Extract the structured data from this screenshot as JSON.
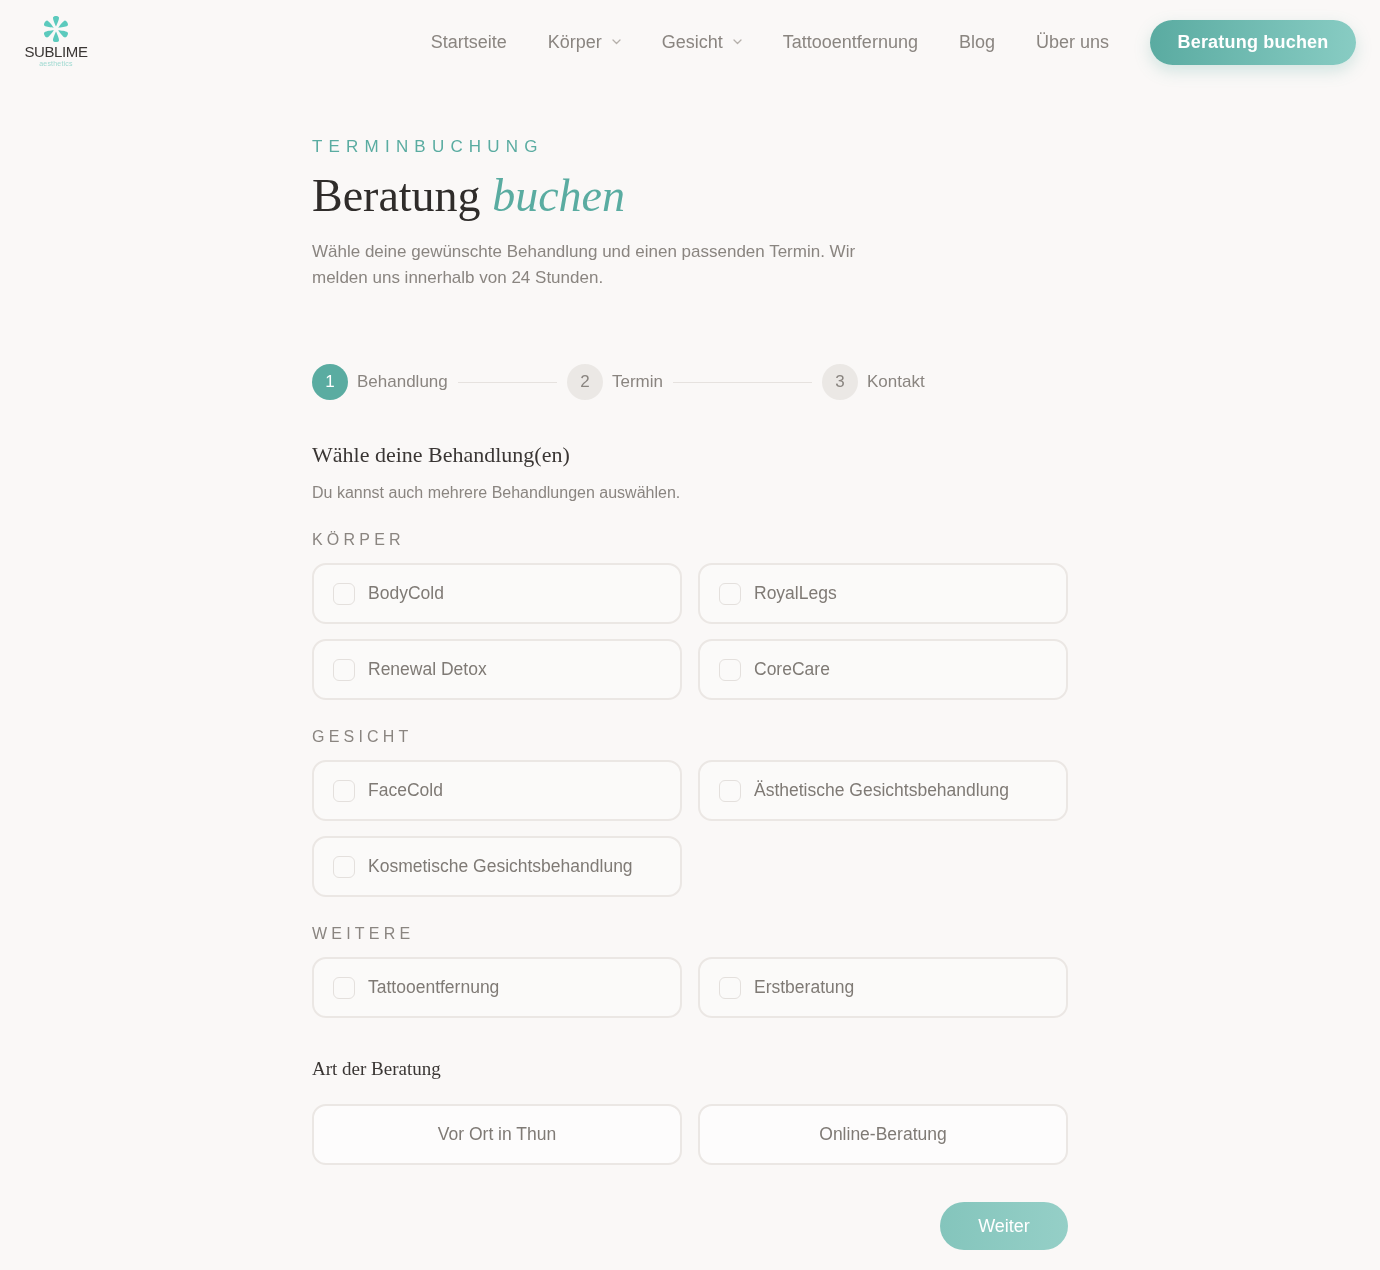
{
  "header": {
    "logo": {
      "name": "SUBLIME",
      "tagline": "aesthetics"
    },
    "nav": [
      {
        "label": "Startseite",
        "dropdown": false
      },
      {
        "label": "Körper",
        "dropdown": true
      },
      {
        "label": "Gesicht",
        "dropdown": true
      },
      {
        "label": "Tattooentfernung",
        "dropdown": false
      },
      {
        "label": "Blog",
        "dropdown": false
      },
      {
        "label": "Über uns",
        "dropdown": false
      }
    ],
    "cta": "Beratung buchen"
  },
  "intro": {
    "eyebrow": "TERMINBUCHUNG",
    "title": "Beratung *buchen*",
    "text": "Wähle deine gewünschte Behandlung und einen passenden Termin. Wir melden uns innerhalb von 24 Stunden."
  },
  "steps": [
    {
      "number": "1",
      "label": "Behandlung",
      "selected": true
    },
    {
      "number": "2",
      "label": "Termin",
      "selected": false
    },
    {
      "number": "3",
      "label": "Kontakt",
      "selected": false
    }
  ],
  "treatments": {
    "title": "Wähle deine Behandlung(en)",
    "hint": "Du kannst auch mehrere Behandlungen auswählen.",
    "groups": [
      {
        "label": "KÖRPER",
        "items": [
          {
            "label": "BodyCold",
            "checked": false
          },
          {
            "label": "RoyalLegs",
            "checked": false
          },
          {
            "label": "Renewal Detox",
            "checked": false
          },
          {
            "label": "CoreCare",
            "checked": false
          }
        ]
      },
      {
        "label": "GESICHT",
        "items": [
          {
            "label": "FaceCold",
            "checked": false
          },
          {
            "label": "Ästhetische Gesichtsbehandlung",
            "checked": false
          },
          {
            "label": "Kosmetische Gesichtsbehandlung",
            "checked": false
          }
        ]
      },
      {
        "label": "WEITERE",
        "items": [
          {
            "label": "Tattooentfernung",
            "checked": false
          },
          {
            "label": "Erstberatung",
            "checked": false
          }
        ]
      }
    ]
  },
  "consultation": {
    "title": "Art der Beratung",
    "options": [
      {
        "label": "Vor Ort in Thun",
        "selected": false
      },
      {
        "label": "Online-Beratung",
        "selected": false
      }
    ]
  },
  "next_button": {
    "label": "Weiter",
    "disabled": true
  }
}
